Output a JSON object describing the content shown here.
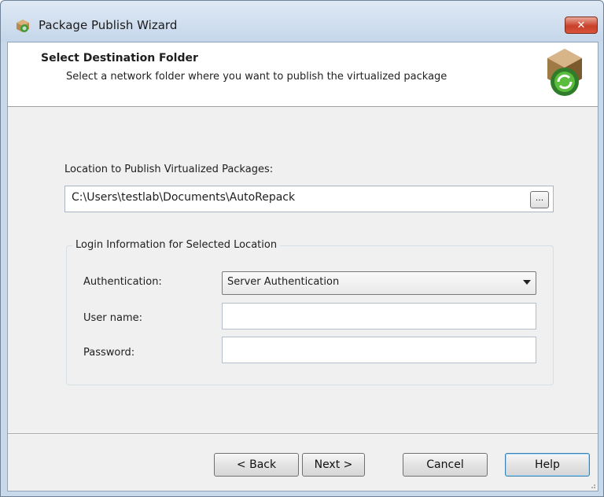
{
  "window": {
    "title": "Package Publish Wizard",
    "close_glyph": "✕",
    "app_icon": "package-icon"
  },
  "header": {
    "title": "Select Destination Folder",
    "subtitle": "Select a network folder where you want to publish the virtualized package",
    "icon": "package-refresh-icon"
  },
  "location": {
    "label": "Location to Publish Virtualized Packages:",
    "value": "C:\\Users\\testlab\\Documents\\AutoRepack",
    "browse_label": "..."
  },
  "login": {
    "legend": "Login Information for Selected Location",
    "authentication_label": "Authentication:",
    "authentication_value": "Server Authentication",
    "username_label": "User name:",
    "username_value": "",
    "password_label": "Password:",
    "password_value": ""
  },
  "buttons": {
    "back": "< Back",
    "next": "Next >",
    "cancel": "Cancel",
    "help": "Help"
  },
  "colors": {
    "titlebar": "#c5d6ea",
    "close": "#c8412a",
    "client_bg": "#f0f0f0",
    "default_button_border": "#3c7fb1"
  }
}
